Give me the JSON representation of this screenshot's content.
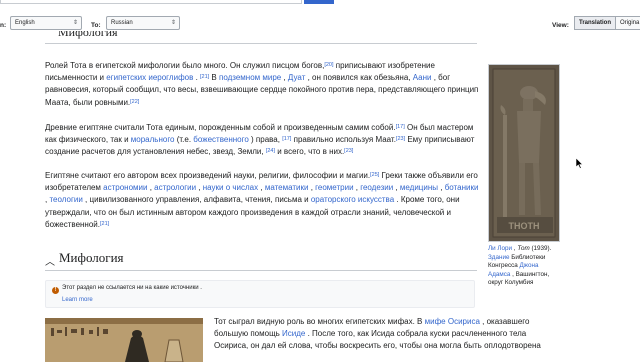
{
  "toolbar": {
    "from_label": "n:",
    "from_value": "English",
    "to_label": "To:",
    "to_value": "Russian",
    "view_label": "View:",
    "view_options": [
      "Translation",
      "Origina"
    ]
  },
  "ghost_heading": "Мифология",
  "paragraphs": {
    "p1": {
      "t1": "Ролей Тота в египетской мифологии было много. Он служил писцом богов,",
      "s1": "[20]",
      "t2": " приписывают изобретение письменности и ",
      "l1": "египетских иероглифов",
      "t3": " . ",
      "s2": "[21]",
      "t4": " В ",
      "l2": "подземном мире",
      "t5": " , ",
      "l3": "Дуат",
      "t6": " , он появился как обезьяна, ",
      "l4": "Аани",
      "t7": " , бог равновесия, который сообщил, что весы, взвешивающие сердце покойного против пера, представляющего принцип Маата, были ровными.",
      "s3": "[22]"
    },
    "p2": {
      "t1": "Древние египтяне считали Тота единым, порожденным собой и произведенным самим собой.",
      "s1": "[17]",
      "t2": " Он был мастером как физического, так и ",
      "l1": "морального",
      "t3": " (т.е. ",
      "l2": "божественного",
      "t4": " ) права, ",
      "s2": "[17]",
      "t5": " правильно используя Маат.",
      "s3": "[23]",
      "t6": " Ему приписывают создание расчетов для установления небес, звезд, Земли, ",
      "s4": "[24]",
      "t7": " и всего, что в них.",
      "s5": "[23]"
    },
    "p3": {
      "t1": "Египтяне считают его автором всех произведений науки, религии, философии и магии.",
      "s1": "[25]",
      "t2": " Греки также объявили его изобретателем ",
      "l1": "астрономии",
      "t3": " , ",
      "l2": "астрологии",
      "t4": " , ",
      "l3": "науки о числах",
      "t5": " , ",
      "l4": "математики",
      "t6": " , ",
      "l5": "геометрии",
      "t7": " , ",
      "l6": "геодезии",
      "t8": " , ",
      "l7": "медицины",
      "t9": " , ",
      "l8": "ботаники",
      "t10": " , ",
      "l9": "теологии",
      "t11": " , цивилизованного управления, алфавита, чтения, письма и ",
      "l10": "ораторского искусства",
      "t12": " . Кроме того, они утверждали, что он был истинным автором каждого произведения в каждой отрасли знаний, человеческой и божественной.",
      "s2": "[21]"
    }
  },
  "figure": {
    "img_text": "THOTH",
    "cap_link1": "Ли Лори",
    "cap_t1": " , ",
    "cap_italic": "Тот",
    "cap_t2": " (1939). ",
    "cap_link2": "Здание",
    "cap_t3": " Библиотеки Конгресса ",
    "cap_link3": "Джона Адамса",
    "cap_t4": " , Вашингтон, округ Колумбия"
  },
  "section": {
    "title": "Мифология"
  },
  "notice": {
    "icon": "!",
    "text": "Этот раздел не ссылается ни на какие источники .",
    "link": "Learn more"
  },
  "p4": {
    "t1": "Тот сыграл видную роль во многих египетских мифах. В ",
    "l1": "мифе Осириса",
    "t2": " , оказавшего большую помощь ",
    "l2": "Исиде",
    "t3": " . После того, как Исида собрала куски расчлененного тела Осириса, он дал ей слова, чтобы воскресить его, чтобы она могла быть оплодотворена"
  },
  "colors": {
    "link": "#3366cc",
    "text": "#202122",
    "notice_icon": "#c05c00"
  }
}
